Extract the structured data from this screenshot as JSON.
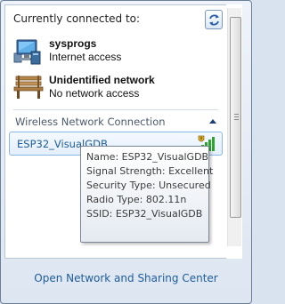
{
  "header": {
    "title": "Currently connected to:",
    "refresh_icon": "refresh-icon"
  },
  "connections": [
    {
      "name": "sysprogs",
      "status": "Internet access",
      "icon": "network-computer-icon"
    },
    {
      "name": "Unidentified network",
      "status": "No network access",
      "icon": "public-bench-icon"
    }
  ],
  "wireless": {
    "section_label": "Wireless Network Connection",
    "networks": [
      {
        "name": "ESP32_VisualGDB",
        "icon": "wifi-signal-unsecured-icon",
        "signal_level": "excellent"
      }
    ]
  },
  "tooltip": {
    "lines": [
      "Name: ESP32_VisualGDB",
      "Signal Strength: Excellent",
      "Security Type: Unsecured",
      "Radio Type: 802.11n",
      "SSID: ESP32_VisualGDB"
    ]
  },
  "footer": {
    "link_label": "Open Network and Sharing Center"
  },
  "colors": {
    "link": "#1f5c99",
    "section_label": "#4a5a6c",
    "selection_border": "#8bb7e6",
    "signal_green": "#2fa52f",
    "warning_shield": "#e0b020"
  }
}
